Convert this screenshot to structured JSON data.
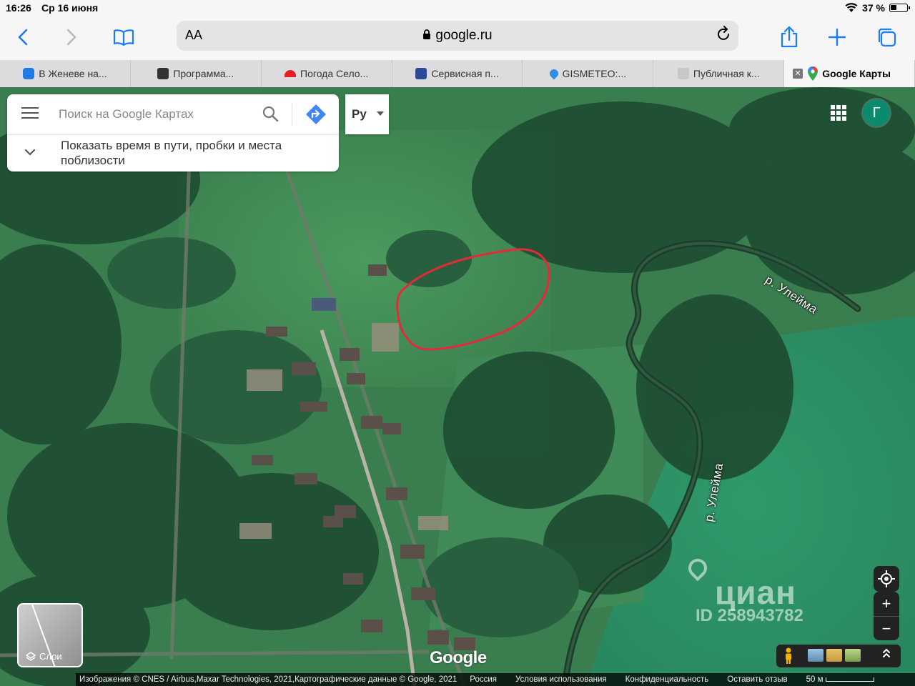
{
  "status_bar": {
    "time": "16:26",
    "date": "Ср 16 июня",
    "battery": "37 %",
    "icons": [
      "wifi-icon",
      "battery-icon"
    ]
  },
  "toolbar": {
    "text_size_label": "AA",
    "url": "google.ru",
    "icons": [
      "back-icon",
      "forward-icon",
      "bookmarks-icon",
      "lock-icon",
      "reload-icon",
      "share-icon",
      "new-tab-icon",
      "tabs-icon"
    ]
  },
  "tabs": [
    {
      "label": "В Женеве на...",
      "favicon_color": "#1f7ae6"
    },
    {
      "label": "Программа...",
      "favicon_color": "#333333"
    },
    {
      "label": "Погода Село...",
      "favicon_color": "#e31e24"
    },
    {
      "label": "Сервисная п...",
      "favicon_color": "#2c4b9a"
    },
    {
      "label": "GISMETEO:...",
      "favicon_color": "#2f8fe6"
    },
    {
      "label": "Публичная к...",
      "favicon_color": "#c8c8c8"
    },
    {
      "label": "Google Карты",
      "favicon_color": "#34a853",
      "active": true
    }
  ],
  "maps": {
    "search_placeholder": "Поиск на Google Картах",
    "suggestion": "Показать время в пути, пробки и места поблизости",
    "language_button": "Ру",
    "avatar_letter": "Г",
    "layers_label": "Слои",
    "logo": "Google",
    "river_labels": [
      "р. Улейма",
      "р. Улейма"
    ],
    "watermark": {
      "brand": "циан",
      "id": "ID 258943782"
    },
    "zoom_in": "+",
    "zoom_out": "−",
    "footer": {
      "imagery": "Изображения © CNES / Airbus,Maxar Technologies, 2021,Картографические данные © Google, 2021",
      "country": "Россия",
      "terms": "Условия использования",
      "privacy": "Конфиденциальность",
      "feedback": "Оставить отзыв",
      "scale": "50 м"
    },
    "colors": {
      "highlight_outline": "#e8283a",
      "avatar": "#0b8a6e",
      "directions": "#4285f4"
    }
  }
}
